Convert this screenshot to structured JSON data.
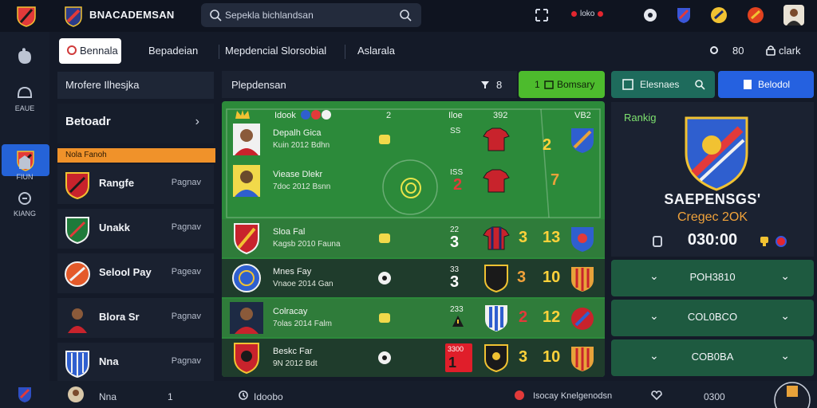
{
  "app": {
    "title": "BNACADEMSAN"
  },
  "search": {
    "text": "Sepekla bichlandsan"
  },
  "top_status": {
    "label": "loko"
  },
  "tabs": [
    {
      "label": "Bennala",
      "active": true
    },
    {
      "label": "Bepadeian"
    },
    {
      "label": "Mepdencial Slorsobial"
    },
    {
      "label": "Aslarala"
    }
  ],
  "top_right": {
    "count": "80",
    "label": "clark"
  },
  "rail": [
    {
      "label": "EAUE"
    },
    {
      "label": "FIUN"
    },
    {
      "label": "KIANG"
    }
  ],
  "list_panel": {
    "header": "Mrofere Ilhesjka",
    "section_title": "Betoadr",
    "orange_label": "Nola Fanoh",
    "rows": [
      {
        "name": "Rangfe",
        "meta": "Pagnav"
      },
      {
        "name": "Unakk",
        "meta": "Pagnav"
      },
      {
        "name": "Selool Pay",
        "meta": "Pageav"
      },
      {
        "name": "Blora Sr",
        "meta": "Pagnav"
      },
      {
        "name": "Nna",
        "meta": "Pagnav"
      }
    ]
  },
  "match_toolbar": {
    "label": "Plepdensan",
    "count": "8",
    "action": "Bomsary",
    "action_num": "1"
  },
  "match_head": {
    "name": "Idook",
    "num": "2",
    "col1": "Iloe",
    "col2": "392",
    "col3": "VB2"
  },
  "matches": [
    {
      "name": "Depalh Gica",
      "sub": "Kuin 2012 Bdhn",
      "c1": "SS",
      "v1": "2",
      "v2": "2"
    },
    {
      "name": "Viease Dlekr",
      "sub": "7doc 2012 Bsnn",
      "c1": "ISS",
      "v1": "2",
      "v2": "7"
    },
    {
      "name": "Sloa Fal",
      "sub": "Kagsb 2010 Fauna",
      "c1": "22",
      "v1": "3",
      "v2": "13"
    },
    {
      "name": "Mnes Fay",
      "sub": "Vnaoe 2014 Gan",
      "c1": "33",
      "v1": "3",
      "v2": "10"
    },
    {
      "name": "Colracay",
      "sub": "7olas 2014 Falm",
      "c1": "233",
      "v1": "2",
      "v2": "12"
    },
    {
      "name": "Beskc Far",
      "sub": "9N 2012 Bdt",
      "c1": "3300",
      "v1": "3",
      "v2": "10"
    }
  ],
  "right_panel": {
    "tab1": "Elesnaes",
    "tab2": "Belodol",
    "ranking_label": "Rankig",
    "team": "SAEPENSGS'",
    "category": "Cregec 2OK",
    "time": "030:00"
  },
  "accordion": [
    {
      "label": "POH3810"
    },
    {
      "label": "COL0BCO"
    },
    {
      "label": "COB0BA"
    }
  ],
  "bottom": {
    "num": "1",
    "item1": "Idoobo",
    "item2": "Isocay Knelgenodsn",
    "item3": "0300"
  },
  "colors": {
    "pitch": "#2c8a3a",
    "accent_blue": "#2563d8",
    "accent_orange": "#f0922a",
    "accent_green": "#1e5a40"
  }
}
